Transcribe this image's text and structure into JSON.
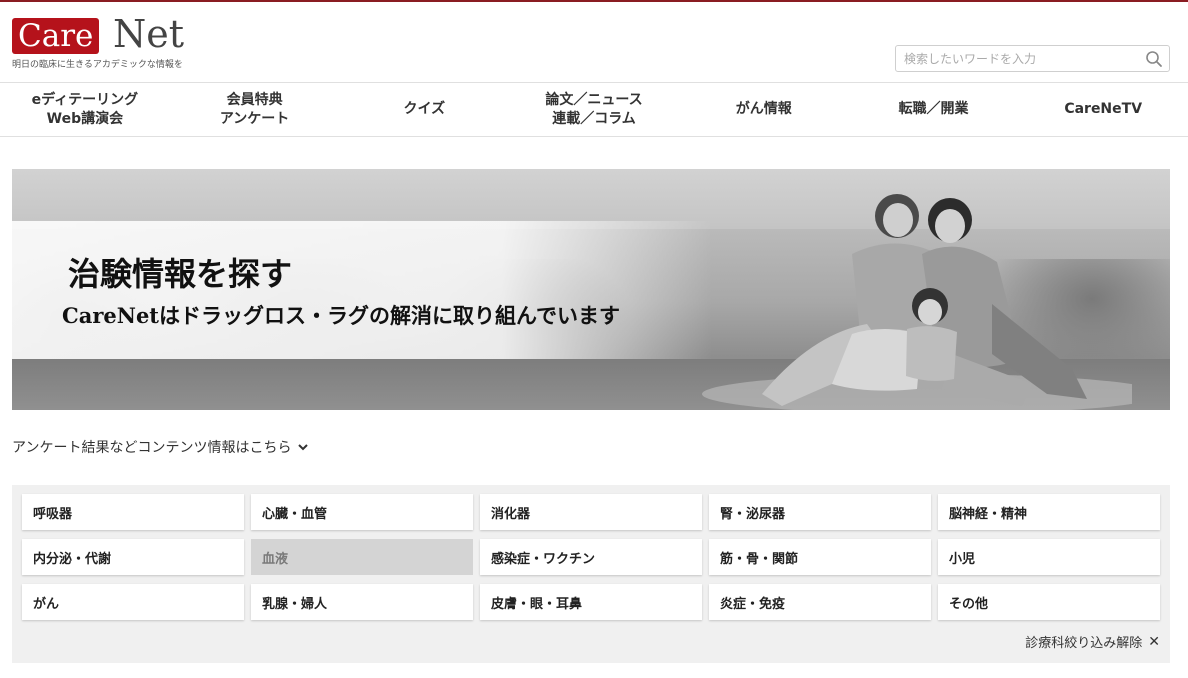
{
  "header": {
    "logo_care": "Care",
    "logo_net": "Net",
    "tagline": "明日の臨床に生きるアカデミックな情報を",
    "search_placeholder": "検索したいワードを入力",
    "search_icon": "search-icon"
  },
  "nav": {
    "items": [
      {
        "line1": "eディテーリング",
        "line2": "Web講演会"
      },
      {
        "line1": "会員特典",
        "line2": "アンケート"
      },
      {
        "line1": "クイズ",
        "line2": ""
      },
      {
        "line1": "論文／ニュース",
        "line2": "連載／コラム"
      },
      {
        "line1": "がん情報",
        "line2": ""
      },
      {
        "line1": "転職／開業",
        "line2": ""
      },
      {
        "line1": "CareNeTV",
        "line2": ""
      }
    ]
  },
  "banner": {
    "title": "治験情報を探す",
    "subtitle": "CareNetはドラッグロス・ラグの解消に取り組んでいます"
  },
  "content_info": {
    "label": "アンケート結果などコンテンツ情報はこちら",
    "icon": "chevron-down-icon"
  },
  "categories": {
    "items": [
      {
        "label": "呼吸器",
        "selected": false
      },
      {
        "label": "心臓・血管",
        "selected": false
      },
      {
        "label": "消化器",
        "selected": false
      },
      {
        "label": "腎・泌尿器",
        "selected": false
      },
      {
        "label": "脳神経・精神",
        "selected": false
      },
      {
        "label": "内分泌・代謝",
        "selected": false
      },
      {
        "label": "血液",
        "selected": true
      },
      {
        "label": "感染症・ワクチン",
        "selected": false
      },
      {
        "label": "筋・骨・関節",
        "selected": false
      },
      {
        "label": "小児",
        "selected": false
      },
      {
        "label": "がん",
        "selected": false
      },
      {
        "label": "乳腺・婦人",
        "selected": false
      },
      {
        "label": "皮膚・眼・耳鼻",
        "selected": false
      },
      {
        "label": "炎症・免疫",
        "selected": false
      },
      {
        "label": "その他",
        "selected": false
      }
    ],
    "clear_label": "診療科絞り込み解除",
    "clear_icon": "✕"
  },
  "colors": {
    "brand_red": "#b5121b",
    "selected_bg": "#d4d4d4"
  }
}
